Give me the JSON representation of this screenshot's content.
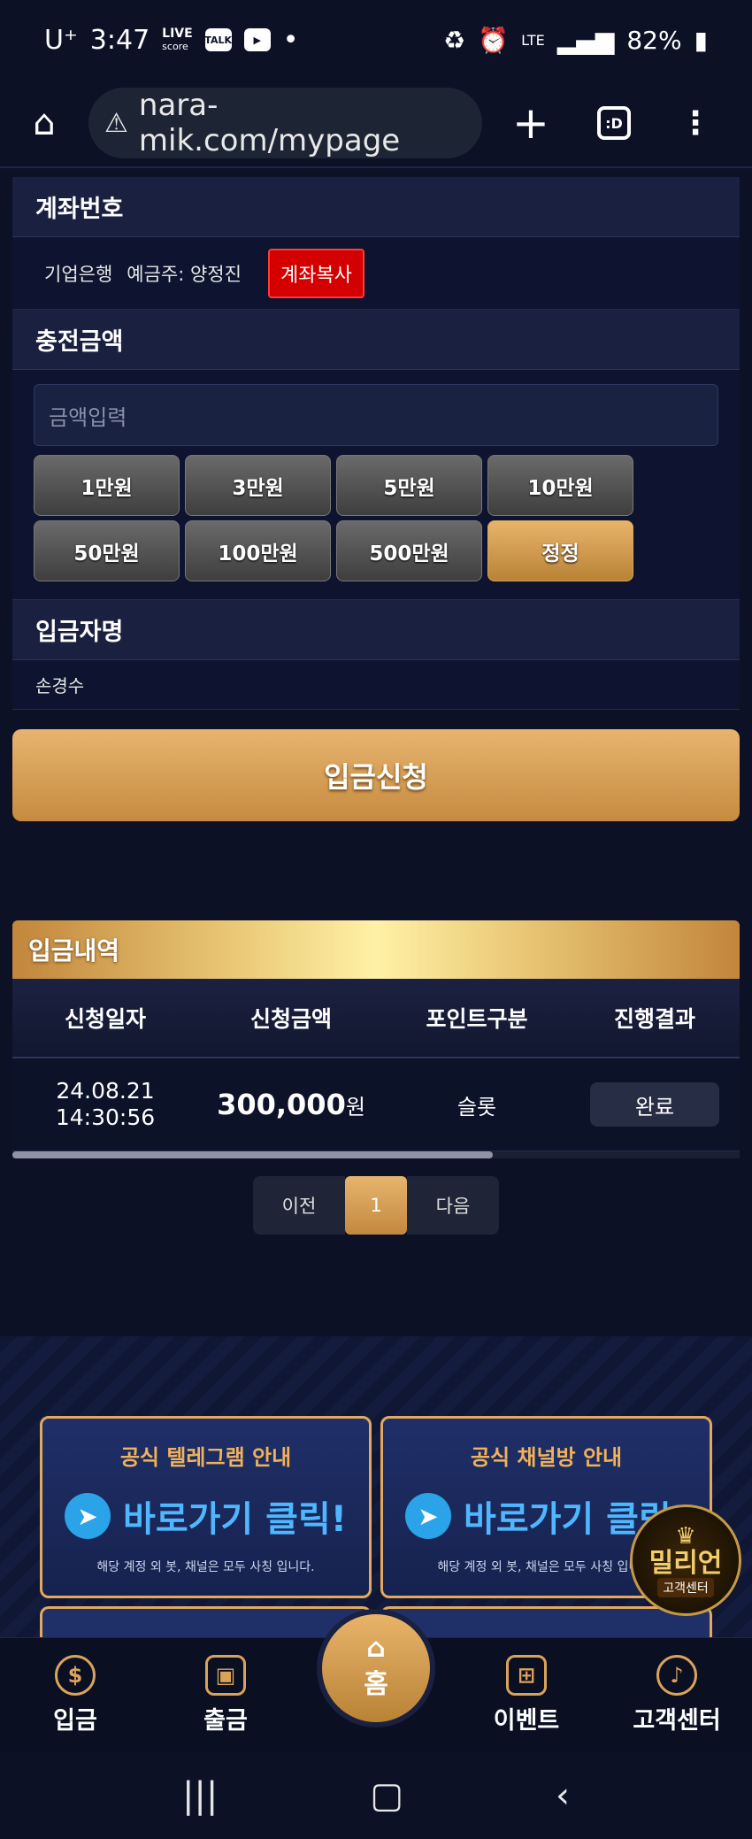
{
  "status_bar": {
    "carrier": "U⁺",
    "time": "3:47",
    "live_label": "LIVE",
    "score_label": "score",
    "talk_label": "TALK",
    "dot": "•",
    "network": "LTE",
    "battery": "82%"
  },
  "browser": {
    "url": "nara-mik.com/mypage",
    "tabs_label": ":D"
  },
  "account": {
    "header": "계좌번호",
    "bank": "기업은행",
    "holder": "예금주: 양정진",
    "copy_label": "계좌복사"
  },
  "charge": {
    "header": "충전금액",
    "placeholder": "금액입력",
    "chips": [
      "1만원",
      "3만원",
      "5만원",
      "10만원",
      "50만원",
      "100만원",
      "500만원",
      "정정"
    ]
  },
  "depositor": {
    "header": "입금자명",
    "name": "손경수"
  },
  "submit_label": "입금신청",
  "history": {
    "title": "입금내역",
    "columns": [
      "신청일자",
      "신청금액",
      "포인트구분",
      "진행결과"
    ],
    "rows": [
      {
        "date": "24.08.21",
        "time": "14:30:56",
        "amount": "300,000",
        "unit": "원",
        "type": "슬롯",
        "status": "완료"
      }
    ],
    "scroll_fraction": 0.66,
    "pager": {
      "prev": "이전",
      "current": "1",
      "next": "다음"
    }
  },
  "banners": [
    {
      "title": "공식 텔레그램 안내",
      "cta": "바로가기 클릭!",
      "note": "해당 계정 외 봇, 채널은 모두 사칭 입니다."
    },
    {
      "title": "공식 채널방 안내",
      "cta": "바로가기 클릭!",
      "note": "해당 계정 외 봇, 채널은 모두 사칭 입니다."
    }
  ],
  "cs_badge": {
    "title": "밀리언",
    "sub": "고객센터"
  },
  "bottom_nav": {
    "items": [
      "입금",
      "출금",
      "홈",
      "이벤트",
      "고객센터"
    ]
  },
  "colors": {
    "background": "#0c1126",
    "gold": "#d9a35a",
    "copy_red": "#d40000",
    "telegram_blue": "#2aa3e8"
  },
  "icons": {
    "home": "home-icon",
    "warning": "warning-icon",
    "plus": "plus-icon",
    "menu": "more-vert-icon",
    "deposit": "dollar-coin-icon",
    "withdraw": "wallet-icon",
    "event": "gift-icon",
    "support": "bell-icon"
  }
}
